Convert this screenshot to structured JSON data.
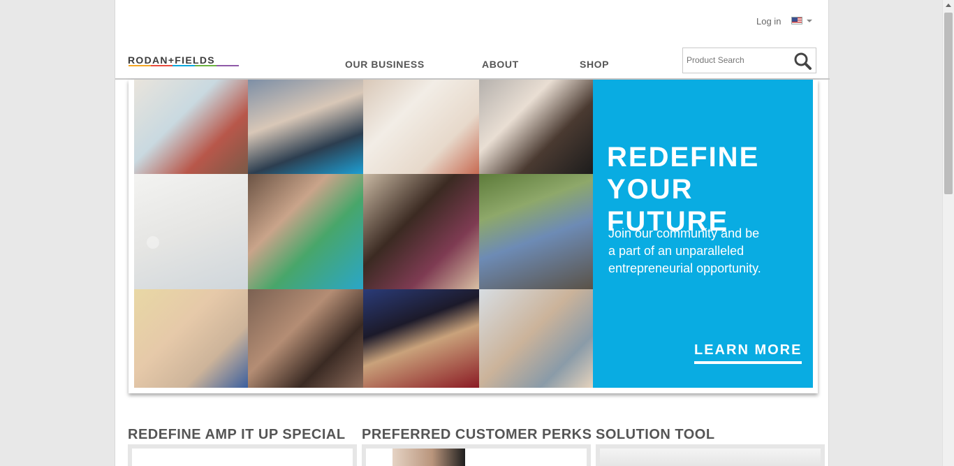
{
  "header": {
    "login_label": "Log in",
    "logo_text": "RODAN+FIELDS",
    "logo_colors": [
      "#f5a623",
      "#e94b3c",
      "#0aa8de",
      "#6cb33f",
      "#8e5aa8"
    ],
    "nav": [
      "OUR BUSINESS",
      "ABOUT",
      "SHOP"
    ],
    "search_placeholder": "Product Search",
    "search_icon": "search-icon"
  },
  "hero": {
    "headline_line1": "REDEFINE",
    "headline_line2": "YOUR FUTURE",
    "body_lines": [
      "Join our community and be",
      "a part of an unparalleled",
      "entrepreneurial opportunity."
    ],
    "cta_label": "LEARN MORE",
    "panel_color": "#09ace2",
    "photo_tiles": 12
  },
  "sections": [
    {
      "title": "REDEFINE AMP IT UP SPECIAL"
    },
    {
      "title": "PREFERRED CUSTOMER PERKS"
    },
    {
      "title": "SOLUTION TOOL"
    }
  ]
}
